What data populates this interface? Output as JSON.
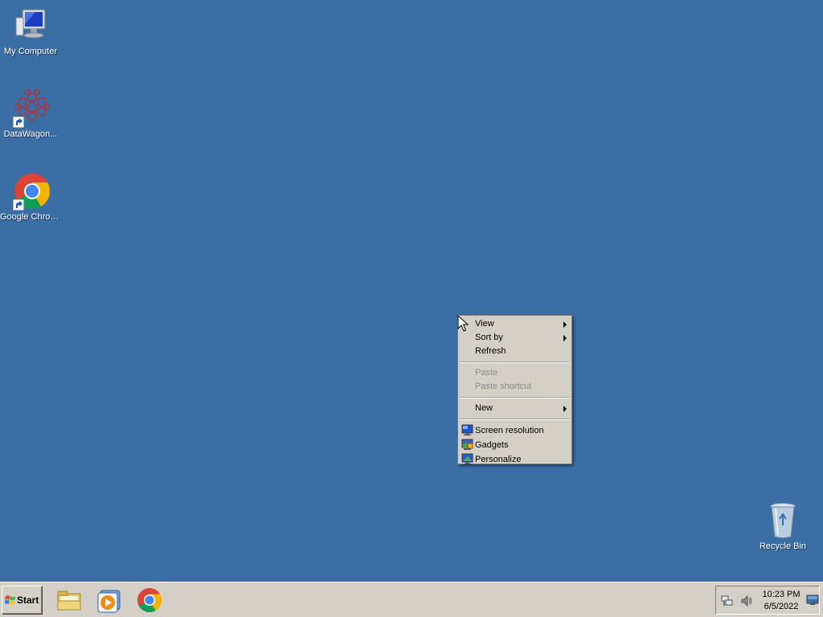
{
  "desktop": {
    "background": "#3a6ea5",
    "icons": [
      {
        "label": "My Computer",
        "icon": "computer-icon"
      },
      {
        "label": "DataWagon...",
        "icon": "datawagon-icon"
      },
      {
        "label": "Google Chrome",
        "icon": "chrome-icon"
      },
      {
        "label": "Recycle Bin",
        "icon": "recycle-bin-icon"
      }
    ]
  },
  "context_menu": {
    "items": [
      {
        "label": "View",
        "submenu": true,
        "enabled": true
      },
      {
        "label": "Sort by",
        "submenu": true,
        "enabled": true
      },
      {
        "label": "Refresh",
        "submenu": false,
        "enabled": true
      },
      {
        "label": "Paste",
        "submenu": false,
        "enabled": false
      },
      {
        "label": "Paste shortcut",
        "submenu": false,
        "enabled": false
      },
      {
        "label": "New",
        "submenu": true,
        "enabled": true
      },
      {
        "label": "Screen resolution",
        "icon": "screen-resolution-icon",
        "enabled": true
      },
      {
        "label": "Gadgets",
        "icon": "gadgets-icon",
        "enabled": true
      },
      {
        "label": "Personalize",
        "icon": "personalize-icon",
        "enabled": true
      }
    ]
  },
  "taskbar": {
    "start_label": "Start",
    "pinned": [
      "file-explorer-icon",
      "media-player-icon",
      "chrome-icon"
    ],
    "tray": [
      "network-icon",
      "volume-icon"
    ],
    "clock": {
      "time": "10:23 PM",
      "date": "6/5/2022"
    }
  }
}
